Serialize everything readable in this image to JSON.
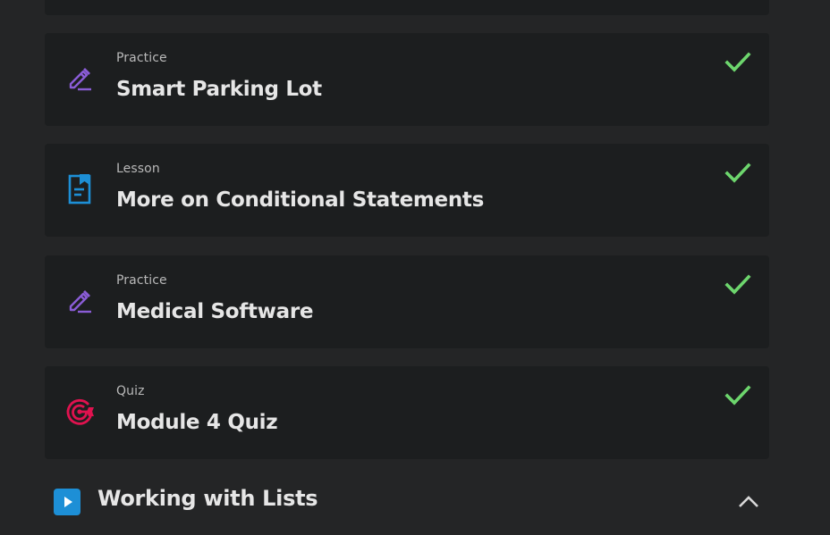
{
  "colors": {
    "background": "#242526",
    "card": "#1c1e1f",
    "practice_icon": "#8a5cd6",
    "lesson_icon": "#1d8fd6",
    "quiz_icon": "#e0124f",
    "check": "#6dd66d"
  },
  "items": [
    {
      "kind": "Practice",
      "title": "Smart Parking Lot",
      "icon": "pencil-icon",
      "completed": true
    },
    {
      "kind": "Lesson",
      "title": "More on Conditional Statements",
      "icon": "document-bookmark-icon",
      "completed": true
    },
    {
      "kind": "Practice",
      "title": "Medical Software",
      "icon": "pencil-icon",
      "completed": true
    },
    {
      "kind": "Quiz",
      "title": "Module 4 Quiz",
      "icon": "target-icon",
      "completed": true
    }
  ],
  "next_section": {
    "title": "Working with Lists",
    "icon": "play-icon",
    "toggle_icon": "chevron-up-icon",
    "expanded": true
  }
}
